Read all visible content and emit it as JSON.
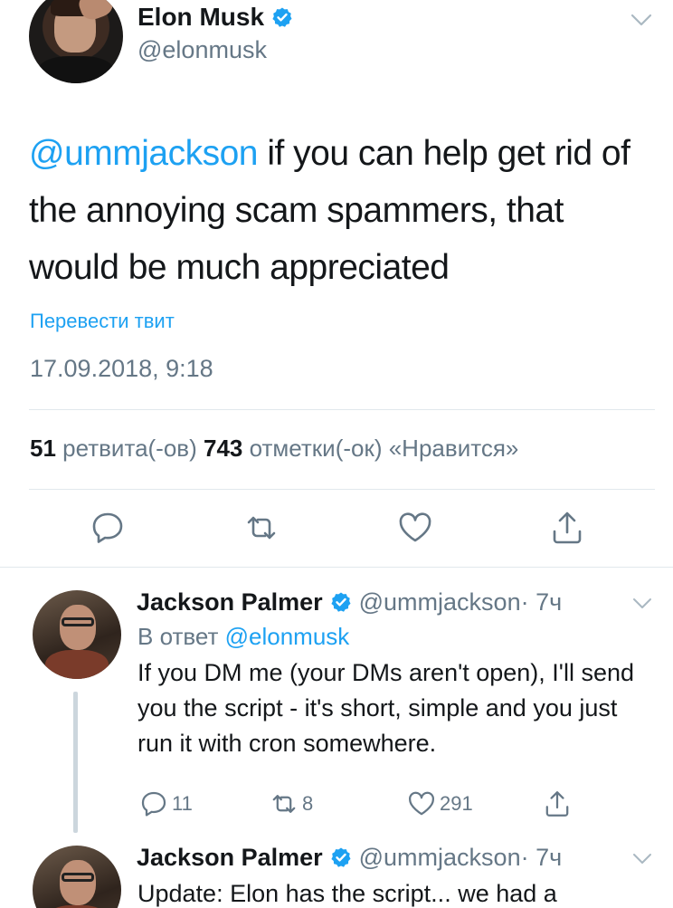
{
  "main_tweet": {
    "author_name": "Elon Musk",
    "author_handle": "@elonmusk",
    "mention": "@ummjackson",
    "text": " if you can help get rid of the annoying scam spammers, that would be much appreciated",
    "translate_label": "Перевести твит",
    "timestamp": "17.09.2018, 9:18",
    "retweets_count": "51",
    "retweets_label": " ретвита(-ов) ",
    "likes_count": "743",
    "likes_label": " отметки(-ок) «Нравится»"
  },
  "replies": [
    {
      "author_name": "Jackson Palmer",
      "author_handle": "@ummjackson",
      "time": " · 7ч",
      "reply_to_prefix": "В ответ ",
      "reply_to_handle": "@elonmusk",
      "text": "If you DM me (your DMs aren't open), I'll send you the script - it's short, simple and you just run it with cron somewhere.",
      "reply_count": "11",
      "retweet_count": "8",
      "like_count": "291"
    },
    {
      "author_name": "Jackson Palmer",
      "author_handle": "@ummjackson",
      "time": " · 7ч",
      "text": "Update: Elon has the script... we had a"
    }
  ],
  "icons": {
    "verified": "verified-badge-icon",
    "reply": "reply-icon",
    "retweet": "retweet-icon",
    "like": "heart-icon",
    "share": "share-icon",
    "menu": "chevron-down-icon"
  },
  "colors": {
    "accent": "#1da1f2",
    "secondary_text": "#657786",
    "primary_text": "#14171a",
    "divider": "#e1e8ed"
  }
}
